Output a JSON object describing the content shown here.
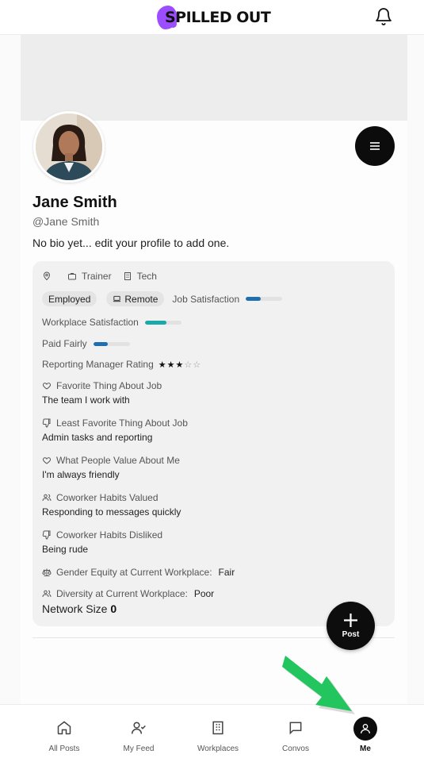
{
  "app": {
    "logo_text": "SPILLED OUT"
  },
  "profile": {
    "name": "Jane Smith",
    "handle": "@Jane Smith",
    "bio": "No bio yet... edit your profile to add one."
  },
  "info": {
    "role": "Trainer",
    "industry": "Tech",
    "employment_status": "Employed",
    "work_mode": "Remote",
    "job_satisfaction_label": "Job Satisfaction",
    "job_satisfaction_level": 0.4,
    "workplace_satisfaction_label": "Workplace Satisfaction",
    "workplace_satisfaction_level": 0.6,
    "paid_fairly_label": "Paid Fairly",
    "paid_fairly_level": 0.4,
    "manager_rating_label": "Reporting Manager Rating",
    "manager_rating_stars": 3,
    "manager_rating_max": 5,
    "favorite_thing_label": "Favorite Thing About Job",
    "favorite_thing_value": "The team I work with",
    "least_favorite_label": "Least Favorite Thing About Job",
    "least_favorite_value": "Admin tasks and reporting",
    "people_value_label": "What People Value About Me",
    "people_value_value": "I'm always friendly",
    "habits_valued_label": "Coworker Habits Valued",
    "habits_valued_value": "Responding to messages quickly",
    "habits_disliked_label": "Coworker Habits Disliked",
    "habits_disliked_value": "Being rude",
    "gender_equity_label": "Gender Equity at Current Workplace:",
    "gender_equity_value": "Fair",
    "diversity_label": "Diversity at Current Workplace:",
    "diversity_value": "Poor",
    "network_size_label": "Network Size",
    "network_size_value": "0"
  },
  "fab": {
    "label": "Post"
  },
  "nav": {
    "items": [
      {
        "label": "All Posts",
        "icon": "home-icon"
      },
      {
        "label": "My Feed",
        "icon": "user-check-icon"
      },
      {
        "label": "Workplaces",
        "icon": "building-icon"
      },
      {
        "label": "Convos",
        "icon": "message-icon"
      },
      {
        "label": "Me",
        "icon": "user-icon"
      }
    ]
  },
  "colors": {
    "accent_teal": "#1aa8a8",
    "accent_blue": "#1f6fb0",
    "logo_purple": "#9b4dff",
    "arrow_green": "#22c55e"
  }
}
